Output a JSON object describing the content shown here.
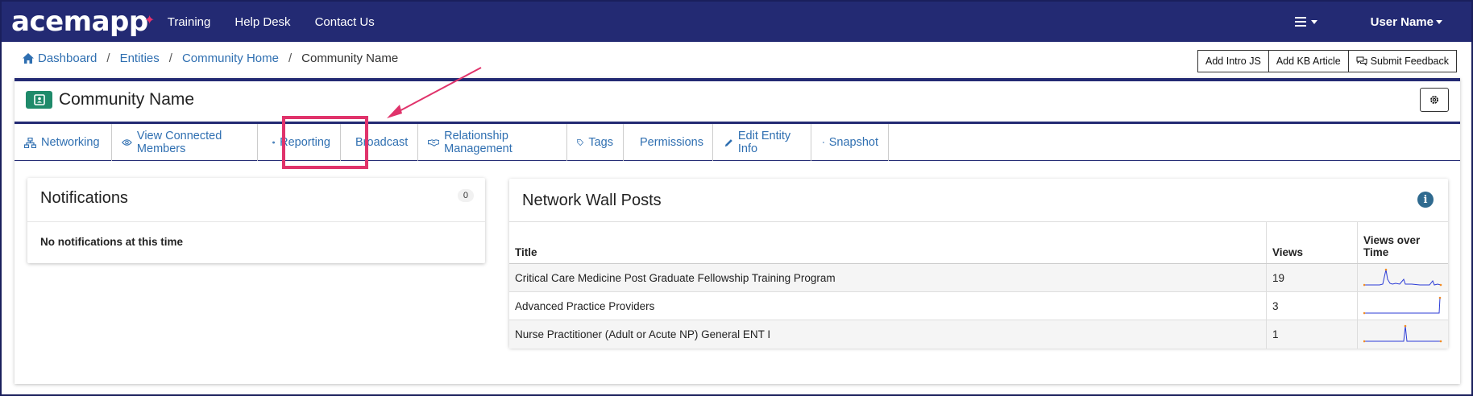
{
  "brand": {
    "logo_text": "acemapp"
  },
  "topnav": {
    "links": [
      "Training",
      "Help Desk",
      "Contact Us"
    ],
    "user_label": "User Name"
  },
  "breadcrumb": {
    "items": [
      "Dashboard",
      "Entities",
      "Community Home",
      "Community Name"
    ]
  },
  "actions": {
    "intro_js": "Add Intro JS",
    "kb_article": "Add KB Article",
    "feedback": "Submit Feedback"
  },
  "entity": {
    "title": "Community Name"
  },
  "tabs": [
    {
      "label": "Networking",
      "icon": "sitemap-icon"
    },
    {
      "label": "View Connected Members",
      "icon": "eye-icon"
    },
    {
      "label": "Reporting",
      "icon": "gauge-icon"
    },
    {
      "label": "Broadcast",
      "icon": "envelope-icon"
    },
    {
      "label": "Relationship Management",
      "icon": "handshake-icon"
    },
    {
      "label": "Tags",
      "icon": "tag-icon"
    },
    {
      "label": "Permissions",
      "icon": "unlock-icon"
    },
    {
      "label": "Edit Entity Info",
      "icon": "pencil-icon"
    },
    {
      "label": "Snapshot",
      "icon": "camera-icon"
    }
  ],
  "notifications": {
    "title": "Notifications",
    "count": "0",
    "empty_text": "No notifications at this time"
  },
  "wall": {
    "title": "Network Wall Posts",
    "columns": [
      "Title",
      "Views",
      "Views over Time"
    ],
    "rows": [
      {
        "title": "Critical Care Medicine Post Graduate Fellowship Training Program",
        "views": "19"
      },
      {
        "title": "Advanced Practice Providers",
        "views": "3"
      },
      {
        "title": "Nurse Practitioner (Adult or Acute NP) General ENT I",
        "views": "1"
      }
    ]
  },
  "colors": {
    "navbar": "#232a73",
    "link": "#2f6fb1",
    "highlight": "#e0336b",
    "entity_icon": "#1f8a6a"
  }
}
